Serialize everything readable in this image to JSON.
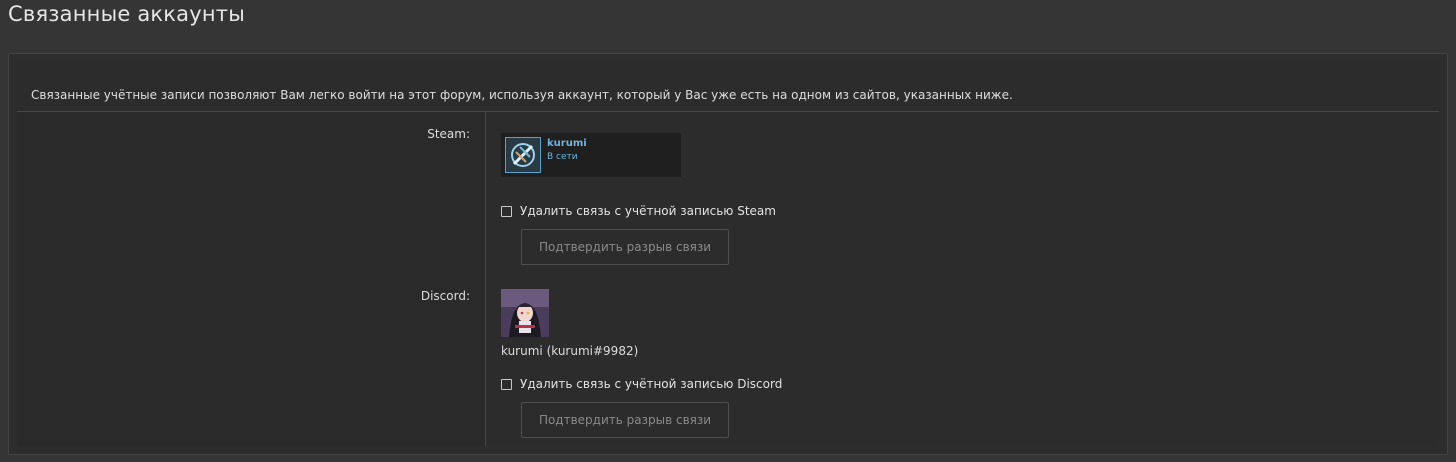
{
  "page": {
    "title": "Связанные аккаунты"
  },
  "explain": "Связанные учётные записи позволяют Вам легко войти на этот форум, используя аккаунт, который у Вас уже есть на одном из сайтов, указанных ниже.",
  "steam": {
    "label": "Steam:",
    "name": "kurumi",
    "status": "В сети",
    "avatar_icon": "steam-avatar-icon",
    "unlink_label": "Удалить связь с учётной записью Steam",
    "confirm_label": "Подтвердить разрыв связи",
    "accent": "#6cb5e0"
  },
  "discord": {
    "label": "Discord:",
    "account": "kurumi (kurumi#9982)",
    "avatar_icon": "discord-avatar-icon",
    "unlink_label": "Удалить связь с учётной записью Discord",
    "confirm_label": "Подтвердить разрыв связи"
  }
}
